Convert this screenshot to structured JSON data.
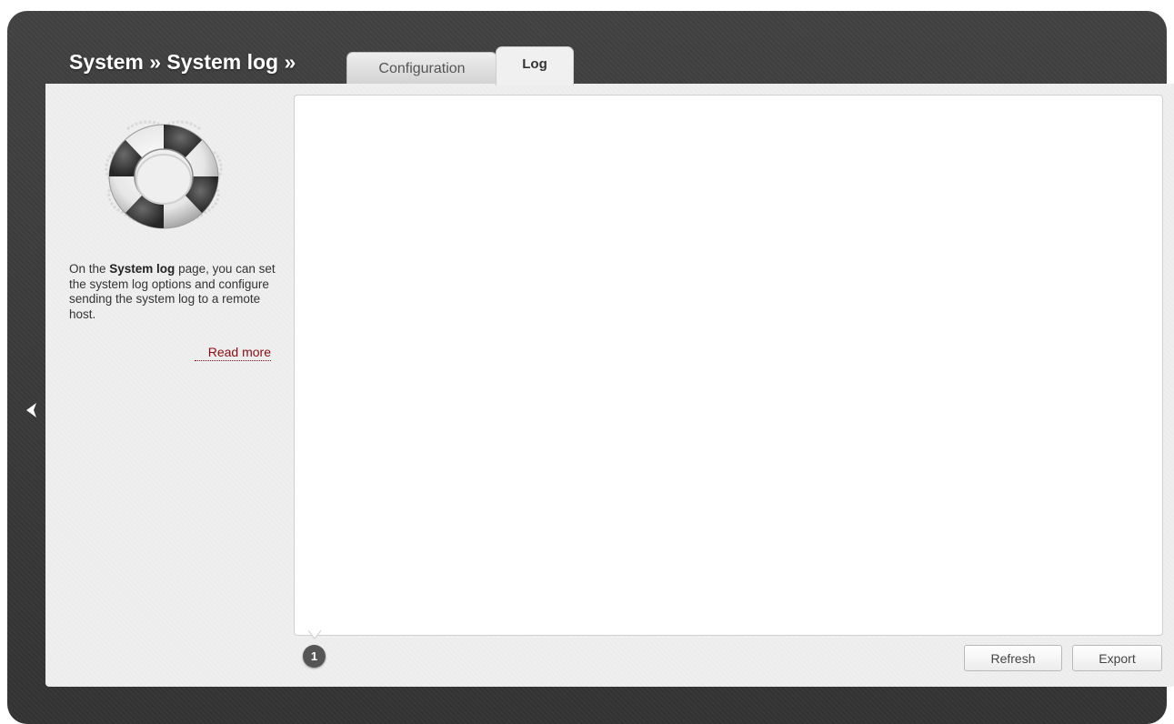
{
  "header": {
    "breadcrumb": "System » System log »"
  },
  "tabs": [
    {
      "label": "Configuration",
      "active": false
    },
    {
      "label": "Log",
      "active": true
    }
  ],
  "sidebar": {
    "icon": "lifebuoy-icon",
    "description_prefix": "On the ",
    "description_bold": "System log",
    "description_suffix": " page, you can set the system log options and configure sending the system log to a remote host.",
    "read_more": "Read more"
  },
  "navigation": {
    "back_icon": "chevron-left-icon"
  },
  "log": {
    "content": "",
    "page_badge": "1"
  },
  "buttons": {
    "refresh": "Refresh",
    "export": "Export"
  },
  "colors": {
    "frame": "#3b3b3b",
    "panel": "#efefef",
    "link": "#8b0d14",
    "badge": "#555555"
  }
}
